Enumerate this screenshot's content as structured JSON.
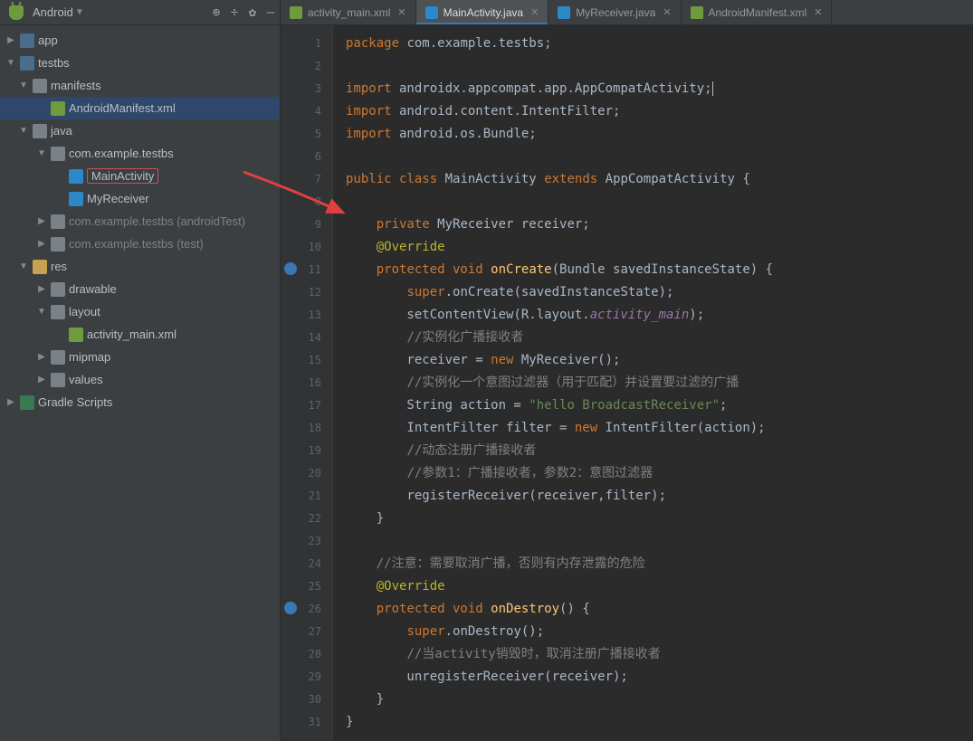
{
  "sidebarHeader": {
    "title": "Android"
  },
  "toolbarIcons": [
    "target-icon",
    "filter-icon",
    "gear-icon",
    "collapse-icon"
  ],
  "tabs": [
    {
      "label": "activity_main.xml",
      "iconClass": "ic-xml",
      "active": false
    },
    {
      "label": "MainActivity.java",
      "iconClass": "ic-java",
      "active": true
    },
    {
      "label": "MyReceiver.java",
      "iconClass": "ic-java",
      "active": false
    },
    {
      "label": "AndroidManifest.xml",
      "iconClass": "ic-mf",
      "active": false
    }
  ],
  "tree": [
    {
      "ind": 0,
      "arrow": "closed",
      "icon": "mod",
      "label": "app"
    },
    {
      "ind": 0,
      "arrow": "open",
      "icon": "mod",
      "label": "testbs"
    },
    {
      "ind": 1,
      "arrow": "open",
      "icon": "dir",
      "label": "manifests"
    },
    {
      "ind": 2,
      "arrow": "none",
      "icon": "xml",
      "label": "AndroidManifest.xml",
      "sel": "pin"
    },
    {
      "ind": 1,
      "arrow": "open",
      "icon": "dir",
      "label": "java"
    },
    {
      "ind": 2,
      "arrow": "open",
      "icon": "pkg",
      "label": "com.example.testbs"
    },
    {
      "ind": 3,
      "arrow": "none",
      "icon": "cls",
      "label": "MainActivity",
      "sel": "red"
    },
    {
      "ind": 3,
      "arrow": "none",
      "icon": "cls",
      "label": "MyReceiver"
    },
    {
      "ind": 2,
      "arrow": "closed",
      "icon": "pkg",
      "label": "com.example.testbs",
      "suffix": " (androidTest)",
      "dim": true
    },
    {
      "ind": 2,
      "arrow": "closed",
      "icon": "pkg",
      "label": "com.example.testbs",
      "suffix": " (test)",
      "dim": true
    },
    {
      "ind": 1,
      "arrow": "open",
      "icon": "res",
      "label": "res"
    },
    {
      "ind": 2,
      "arrow": "closed",
      "icon": "dir",
      "label": "drawable"
    },
    {
      "ind": 2,
      "arrow": "open",
      "icon": "dir",
      "label": "layout"
    },
    {
      "ind": 3,
      "arrow": "none",
      "icon": "xml",
      "label": "activity_main.xml"
    },
    {
      "ind": 2,
      "arrow": "closed",
      "icon": "dir",
      "label": "mipmap"
    },
    {
      "ind": 2,
      "arrow": "closed",
      "icon": "dir",
      "label": "values"
    },
    {
      "ind": 0,
      "arrow": "closed",
      "icon": "gr",
      "label": "Gradle Scripts"
    }
  ],
  "code": [
    {
      "n": 1,
      "h": "<span class='kw'>package</span> com.example.testbs;"
    },
    {
      "n": 2,
      "h": ""
    },
    {
      "n": 3,
      "h": "<span class='kw'>import</span> androidx.appcompat.app.AppCompatActivity;<span class='cur'></span>"
    },
    {
      "n": 4,
      "h": "<span class='kw'>import</span> android.content.IntentFilter;"
    },
    {
      "n": 5,
      "h": "<span class='kw'>import</span> android.os.Bundle;"
    },
    {
      "n": 6,
      "h": ""
    },
    {
      "n": 7,
      "h": "<span class='kw'>public class</span> <span class='typ'>MainActivity</span> <span class='kw'>extends</span> <span class='typ'>AppCompatActivity</span> {",
      "mark": "ann"
    },
    {
      "n": 8,
      "h": ""
    },
    {
      "n": 9,
      "h": "    <span class='kw'>private</span> MyReceiver receiver;"
    },
    {
      "n": 10,
      "h": "    <span class='ann'>@Override</span>"
    },
    {
      "n": 11,
      "h": "    <span class='kw'>protected void</span> <span class='fn'>onCreate</span>(Bundle savedInstanceState) {",
      "mark": "ov"
    },
    {
      "n": 12,
      "h": "        <span class='kw'>super</span>.onCreate(savedInstanceState);"
    },
    {
      "n": 13,
      "h": "        setContentView(R.layout.<span class='it'>activity_main</span>);"
    },
    {
      "n": 14,
      "h": "        <span class='cmt'>//实例化广播接收者</span>"
    },
    {
      "n": 15,
      "h": "        receiver = <span class='kw'>new</span> MyReceiver();"
    },
    {
      "n": 16,
      "h": "        <span class='cmt'>//实例化一个意图过滤器（用于匹配）并设置要过滤的广播</span>"
    },
    {
      "n": 17,
      "h": "        String action = <span class='str'>\"hello BroadcastReceiver\"</span>;"
    },
    {
      "n": 18,
      "h": "        IntentFilter filter = <span class='kw'>new</span> IntentFilter(action);"
    },
    {
      "n": 19,
      "h": "        <span class='cmt'>//动态注册广播接收者</span>"
    },
    {
      "n": 20,
      "h": "        <span class='cmt'>//参数1：广播接收者，参数2：意图过滤器</span>"
    },
    {
      "n": 21,
      "h": "        registerReceiver(receiver,filter);"
    },
    {
      "n": 22,
      "h": "    }"
    },
    {
      "n": 23,
      "h": ""
    },
    {
      "n": 24,
      "h": "    <span class='cmt'>//注意：需要取消广播，否则有内存泄露的危险</span>"
    },
    {
      "n": 25,
      "h": "    <span class='ann'>@Override</span>"
    },
    {
      "n": 26,
      "h": "    <span class='kw'>protected void</span> <span class='fn'>onDestroy</span>() {",
      "mark": "ov"
    },
    {
      "n": 27,
      "h": "        <span class='kw'>super</span>.onDestroy();"
    },
    {
      "n": 28,
      "h": "        <span class='cmt'>//当activity销毁时，取消注册广播接收者</span>"
    },
    {
      "n": 29,
      "h": "        unregisterReceiver(receiver);"
    },
    {
      "n": 30,
      "h": "    }"
    },
    {
      "n": 31,
      "h": "}"
    }
  ]
}
